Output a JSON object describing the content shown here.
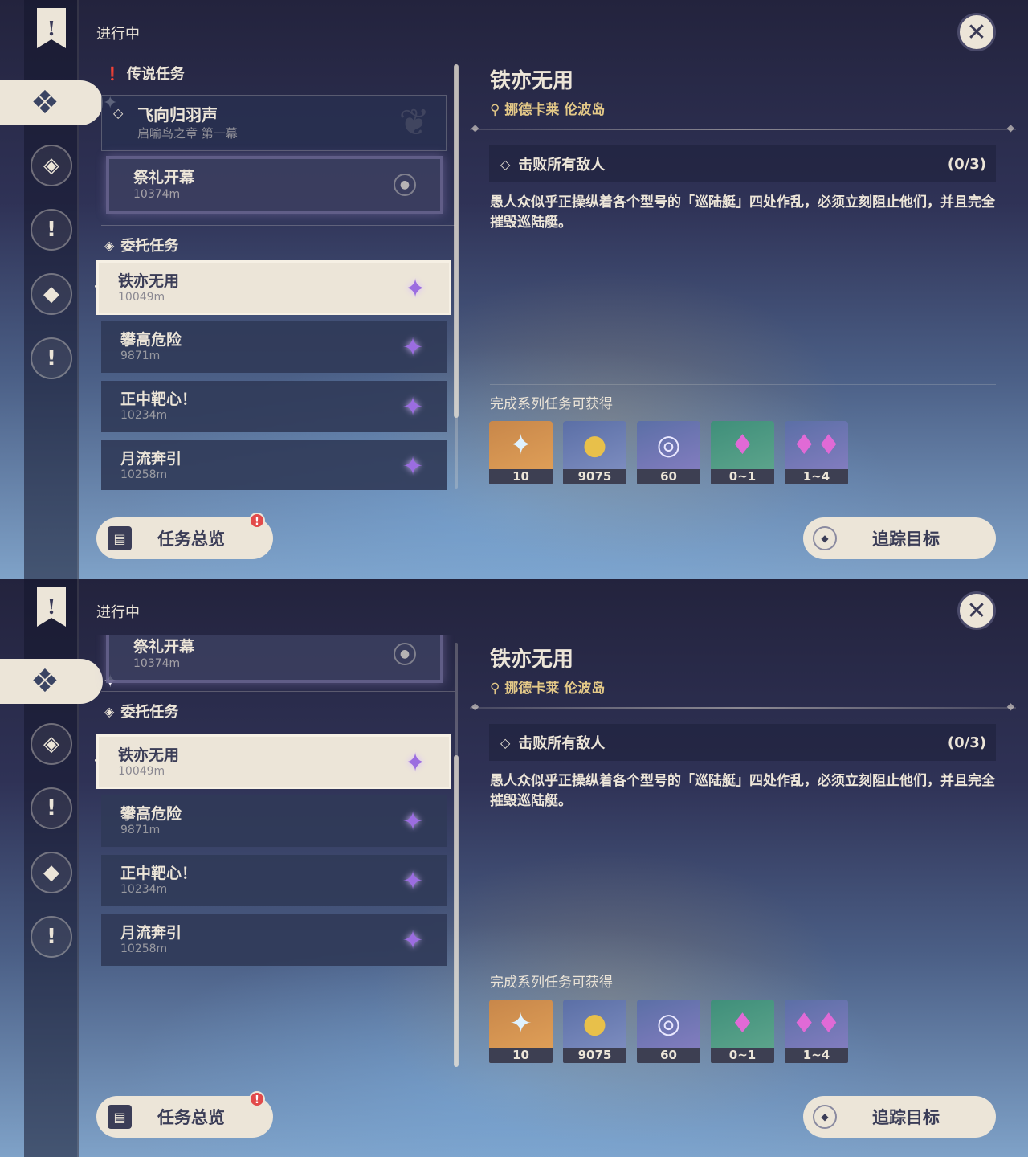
{
  "panels": [
    {
      "section_label": "进行中",
      "legend_category": "传说任务",
      "legend_quest": {
        "title": "飞向归羽声",
        "subtitle": "启喻鸟之章 第一幕"
      },
      "legend_sub": {
        "title": "祭礼开幕",
        "distance": "10374m"
      },
      "commission_category": "委托任务",
      "quests": [
        {
          "title": "铁亦无用",
          "distance": "10049m"
        },
        {
          "title": "攀高危险",
          "distance": "9871m"
        },
        {
          "title": "正中靶心！",
          "distance": "10234m"
        },
        {
          "title": "月流奔引",
          "distance": "10258m"
        }
      ]
    },
    {
      "section_label": "进行中",
      "legend_sub": {
        "title": "祭礼开幕",
        "distance": "10374m"
      },
      "commission_category": "委托任务",
      "quests": [
        {
          "title": "铁亦无用",
          "distance": "10049m"
        },
        {
          "title": "攀高危险",
          "distance": "9871m"
        },
        {
          "title": "正中靶心！",
          "distance": "10234m"
        },
        {
          "title": "月流奔引",
          "distance": "10258m"
        }
      ]
    }
  ],
  "detail": {
    "title": "铁亦无用",
    "location": "挪德卡莱 伦波岛",
    "objective": "击败所有敌人",
    "progress": "(0/3)",
    "description": "愚人众似乎正操纵着各个型号的「巡陆艇」四处作乱，必须立刻阻止他们，并且完全摧毁巡陆艇。",
    "rewards_heading": "完成系列任务可获得",
    "rewards": [
      {
        "icon": "primogem-icon",
        "count": "10"
      },
      {
        "icon": "mora-coin-icon",
        "count": "9075"
      },
      {
        "icon": "fate-ring-icon",
        "count": "60"
      },
      {
        "icon": "crystal-single-icon",
        "count": "0~1"
      },
      {
        "icon": "crystal-cluster-icon",
        "count": "1~4"
      }
    ]
  },
  "buttons": {
    "overview": "任务总览",
    "track": "追踪目标",
    "badge": "!"
  },
  "colors": {
    "accent_cream": "#ece5d8",
    "dark_text": "#3b3d57",
    "location_gold": "#e3c887",
    "badge_red": "#e24a4a",
    "star_purple": "#9b6de0"
  }
}
